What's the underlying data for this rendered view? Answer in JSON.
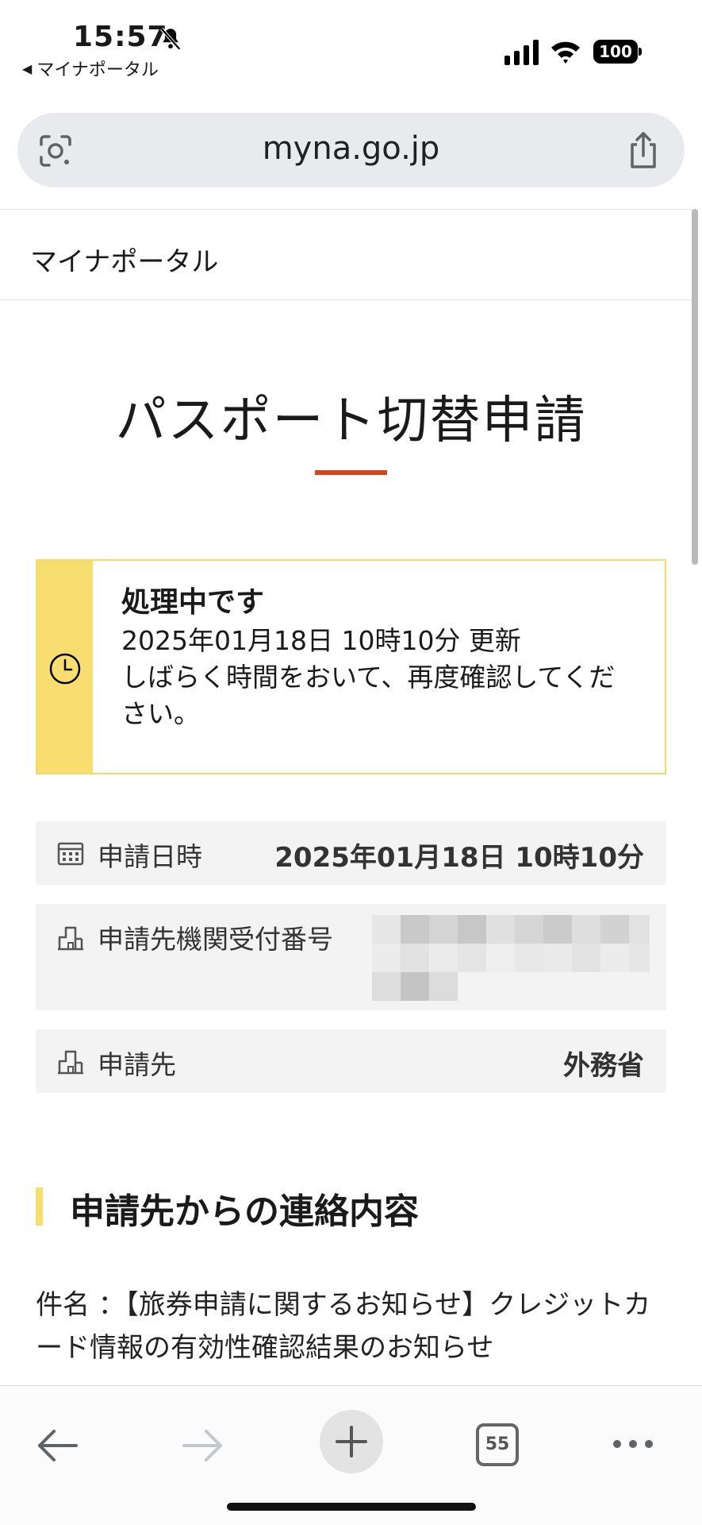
{
  "status_bar": {
    "time": "15:57",
    "back_app": "マイナポータル",
    "battery": "100"
  },
  "browser": {
    "url": "myna.go.jp",
    "tab_count": "55"
  },
  "site": {
    "title": "マイナポータル"
  },
  "page": {
    "title": "パスポート切替申請",
    "accent_color": "#d9441e"
  },
  "notice": {
    "heading": "処理中です",
    "updated": "2025年01月18日 10時10分 更新",
    "message": "しばらく時間をおいて、再度確認してください。",
    "accent_color": "#f7de6f"
  },
  "info_rows": [
    {
      "label": "申請日時",
      "value": "2025年01月18日 10時10分",
      "icon": "calendar-icon"
    },
    {
      "label": "申請先機関受付番号",
      "value": "",
      "icon": "building-icon"
    },
    {
      "label": "申請先",
      "value": "外務省",
      "icon": "building-icon"
    }
  ],
  "section": {
    "title": "申請先からの連絡内容",
    "message": "件名 ：【旅券申請に関するお知らせ】クレジットカード情報の有効性確認結果のお知らせ"
  }
}
